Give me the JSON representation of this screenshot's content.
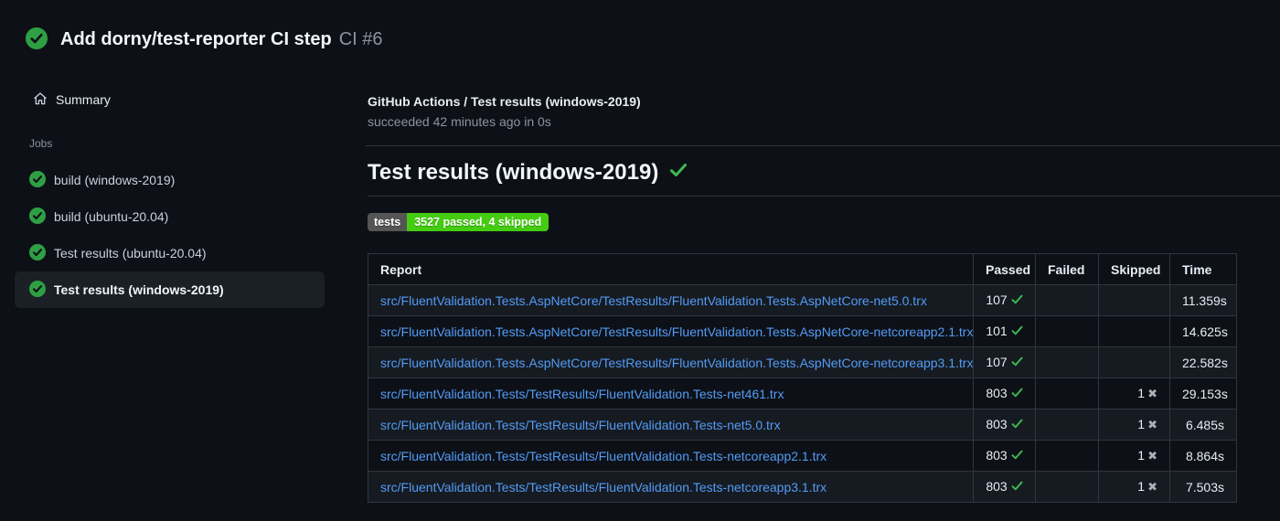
{
  "header": {
    "title": "Add dorny/test-reporter CI step",
    "run_number": "CI #6"
  },
  "sidebar": {
    "summary_label": "Summary",
    "jobs_label": "Jobs",
    "jobs": [
      {
        "label": "build (windows-2019)",
        "selected": false
      },
      {
        "label": "build (ubuntu-20.04)",
        "selected": false
      },
      {
        "label": "Test results (ubuntu-20.04)",
        "selected": false
      },
      {
        "label": "Test results (windows-2019)",
        "selected": true
      }
    ]
  },
  "main": {
    "check_run_title": "GitHub Actions / Test results (windows-2019)",
    "check_run_status": "succeeded 42 minutes ago in 0s",
    "section_title": "Test results (windows-2019)",
    "badge": {
      "label": "tests",
      "value": "3527 passed, 4 skipped",
      "label_bg": "#555555",
      "value_bg": "#44cc11"
    },
    "table": {
      "columns": [
        "Report",
        "Passed",
        "Failed",
        "Skipped",
        "Time"
      ],
      "rows": [
        {
          "report": "src/FluentValidation.Tests.AspNetCore/TestResults/FluentValidation.Tests.AspNetCore-net5.0.trx",
          "passed": "107",
          "failed": "",
          "skipped": "",
          "time": "11.359s"
        },
        {
          "report": "src/FluentValidation.Tests.AspNetCore/TestResults/FluentValidation.Tests.AspNetCore-netcoreapp2.1.trx",
          "passed": "101",
          "failed": "",
          "skipped": "",
          "time": "14.625s"
        },
        {
          "report": "src/FluentValidation.Tests.AspNetCore/TestResults/FluentValidation.Tests.AspNetCore-netcoreapp3.1.trx",
          "passed": "107",
          "failed": "",
          "skipped": "",
          "time": "22.582s"
        },
        {
          "report": "src/FluentValidation.Tests/TestResults/FluentValidation.Tests-net461.trx",
          "passed": "803",
          "failed": "",
          "skipped": "1",
          "time": "29.153s"
        },
        {
          "report": "src/FluentValidation.Tests/TestResults/FluentValidation.Tests-net5.0.trx",
          "passed": "803",
          "failed": "",
          "skipped": "1",
          "time": "6.485s"
        },
        {
          "report": "src/FluentValidation.Tests/TestResults/FluentValidation.Tests-netcoreapp2.1.trx",
          "passed": "803",
          "failed": "",
          "skipped": "1",
          "time": "8.864s"
        },
        {
          "report": "src/FluentValidation.Tests/TestResults/FluentValidation.Tests-netcoreapp3.1.trx",
          "passed": "803",
          "failed": "",
          "skipped": "1",
          "time": "7.503s"
        }
      ]
    }
  },
  "colors": {
    "background": "#0d1117",
    "success_circle": "#2ea043",
    "success_check": "#3fb950",
    "link": "#539bf5",
    "muted": "#8b949e",
    "border": "#30363d",
    "row_alt": "#161b22"
  }
}
